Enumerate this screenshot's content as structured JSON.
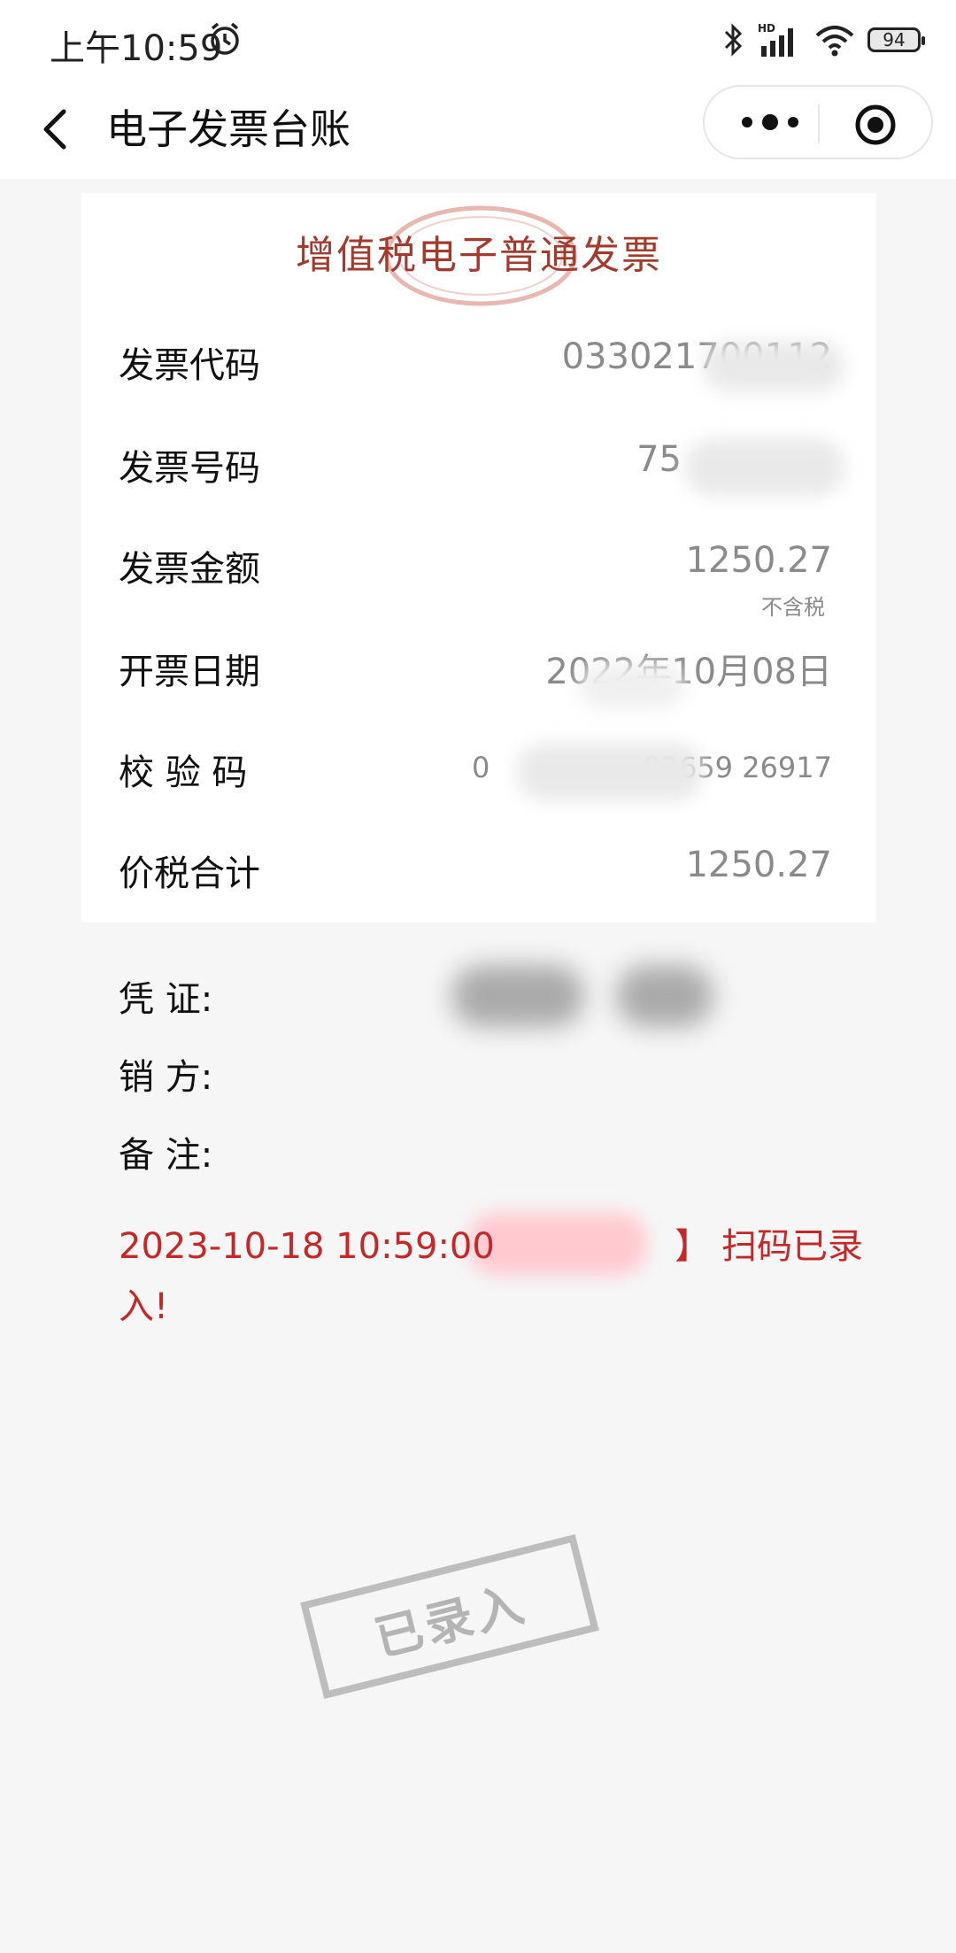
{
  "status_bar": {
    "time": "上午10:59",
    "network": "HD",
    "battery": "94"
  },
  "nav": {
    "title": "电子发票台账"
  },
  "invoice": {
    "title": "增值税电子普通发票",
    "rows": [
      {
        "label": "发票代码",
        "value": "033021700112"
      },
      {
        "label": "发票号码",
        "value": "75"
      },
      {
        "label": "发票金额",
        "value": "1250.27",
        "sub": "不含税"
      },
      {
        "label": "开票日期",
        "value": "2022年10月08日"
      },
      {
        "label": "校 验 码",
        "value": "0                 02659 26917"
      },
      {
        "label": "价税合计",
        "value": "1250.27"
      }
    ]
  },
  "details": {
    "voucher_label": "凭 证:",
    "seller_label": "销 方:",
    "remark_label": "备 注:"
  },
  "message": {
    "line1": "2023-10-18 10:59:00                】 扫码已录",
    "line2": "入!"
  },
  "stamp": {
    "text": "已录入"
  },
  "colors": {
    "accent_red": "#c62828",
    "title_red": "#a33a2e",
    "background": "#f6f6f6"
  }
}
